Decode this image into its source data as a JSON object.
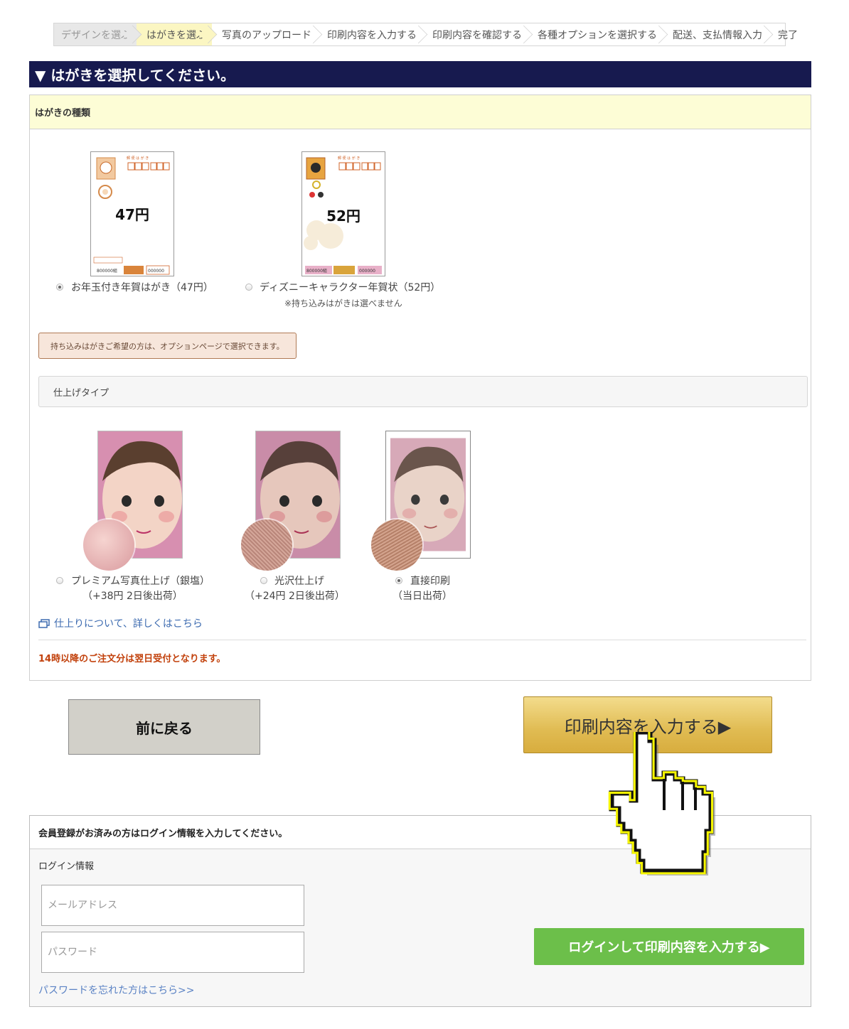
{
  "steps": [
    {
      "label": "デザインを選ぶ",
      "state": "done"
    },
    {
      "label": "はがきを選ぶ",
      "state": "current"
    },
    {
      "label": "写真のアップロード",
      "state": "todo"
    },
    {
      "label": "印刷内容を入力する",
      "state": "todo"
    },
    {
      "label": "印刷内容を確認する",
      "state": "todo"
    },
    {
      "label": "各種オプションを選択する",
      "state": "todo"
    },
    {
      "label": "配送、支払情報入力",
      "state": "todo"
    },
    {
      "label": "完了",
      "state": "todo"
    }
  ],
  "title": "▼ はがきを選択してください。",
  "card_type": {
    "heading": "はがきの種類",
    "options": [
      {
        "price_label": "47円",
        "label": "お年玉付き年賀はがき（47円）",
        "selected": true,
        "note": ""
      },
      {
        "price_label": "52円",
        "label": "ディズニーキャラクター年賀状（52円）",
        "selected": false,
        "note": "※持ち込みはがきは選べません"
      }
    ],
    "bring_note": "持ち込みはがきご希望の方は、オプションページで選択できます。"
  },
  "finish_type": {
    "heading": "仕上げタイプ",
    "options": [
      {
        "label": "プレミアム写真仕上げ（銀塩）",
        "sub": "（+38円 2日後出荷）",
        "selected": false
      },
      {
        "label": "光沢仕上げ",
        "sub": "（+24円 2日後出荷）",
        "selected": false
      },
      {
        "label": "直接印刷",
        "sub": "（当日出荷）",
        "selected": true
      }
    ],
    "more_link": "仕上りについて、詳しくはこちら",
    "warning": "14時以降のご注文分は翌日受付となります。"
  },
  "buttons": {
    "back": "前に戻る",
    "next": "印刷内容を入力する▶"
  },
  "login": {
    "heading": "会員登録がお済みの方はログイン情報を入力してください。",
    "label": "ログイン情報",
    "email_placeholder": "メールアドレス",
    "password_placeholder": "パスワード",
    "forgot": "パスワードを忘れた方はこちら>>",
    "submit": "ログインして印刷内容を入力する▶"
  },
  "colors": {
    "title_bg": "#171a4f",
    "step_current": "#fbf6c2",
    "next_button": "#e0bb52",
    "login_button": "#6cbf4a",
    "warning": "#c2410c"
  }
}
